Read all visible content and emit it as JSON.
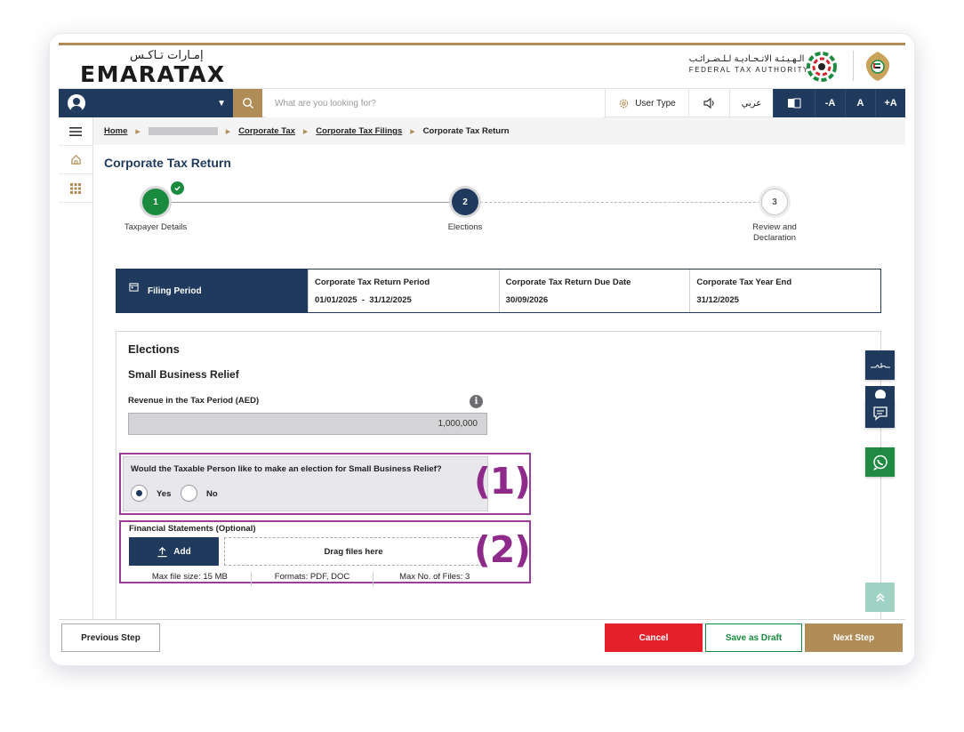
{
  "brand": {
    "logo_ar": "إمـارات تـاكـس",
    "logo_en": "MARATAX",
    "logo_en_first": "E",
    "authority_ar": "الـهـيـئـة الاتـحـاديـة لـلـضـرائـب",
    "authority_en": "FEDERAL TAX AUTHORITY"
  },
  "topbar": {
    "search_placeholder": "What are you looking for?",
    "user_type_label": "User Type",
    "language_label": "عربي",
    "font_decrease": "-A",
    "font_normal": "A",
    "font_increase": "+A"
  },
  "breadcrumb": {
    "home": "Home",
    "corporate_tax": "Corporate Tax",
    "filings": "Corporate Tax Filings",
    "current": "Corporate Tax Return"
  },
  "page": {
    "title": "Corporate Tax Return"
  },
  "stepper": {
    "steps": [
      {
        "number": "1",
        "label": "Taxpayer Details",
        "state": "completed"
      },
      {
        "number": "2",
        "label": "Elections",
        "state": "active"
      },
      {
        "number": "3",
        "label_line1": "Review and",
        "label_line2": "Declaration",
        "state": "pending"
      }
    ]
  },
  "filing_period": {
    "header": "Filing Period",
    "return_period_label": "Corporate Tax Return Period",
    "return_period_value": "01/01/2025  -  31/12/2025",
    "due_date_label": "Corporate Tax Return Due Date",
    "due_date_value": "30/09/2026",
    "year_end_label": "Corporate Tax Year End",
    "year_end_value": "31/12/2025"
  },
  "elections": {
    "heading": "Elections",
    "subheading": "Small Business Relief",
    "revenue_label": "Revenue in the Tax Period (AED)",
    "revenue_value": "1,000,000",
    "question": "Would the Taxable Person like to make an election for Small Business Relief?",
    "option_yes": "Yes",
    "option_no": "No",
    "selected": "Yes",
    "callout_1": "(1)",
    "callout_2": "(2)"
  },
  "upload": {
    "label": "Financial Statements (Optional)",
    "add_label": "Add",
    "drop_label": "Drag files here",
    "max_size": "Max file size: 15 MB",
    "formats": "Formats: PDF, DOC",
    "max_files": "Max No. of Files: 3"
  },
  "footer": {
    "previous": "Previous Step",
    "cancel": "Cancel",
    "save_draft": "Save as Draft",
    "next": "Next Step"
  },
  "colors": {
    "navy": "#1f3a5c",
    "gold": "#b08d57",
    "green": "#1a8a3e",
    "red": "#e5202b",
    "callout_purple": "#8e2a8a",
    "whatsapp_green": "#1f8a42"
  }
}
